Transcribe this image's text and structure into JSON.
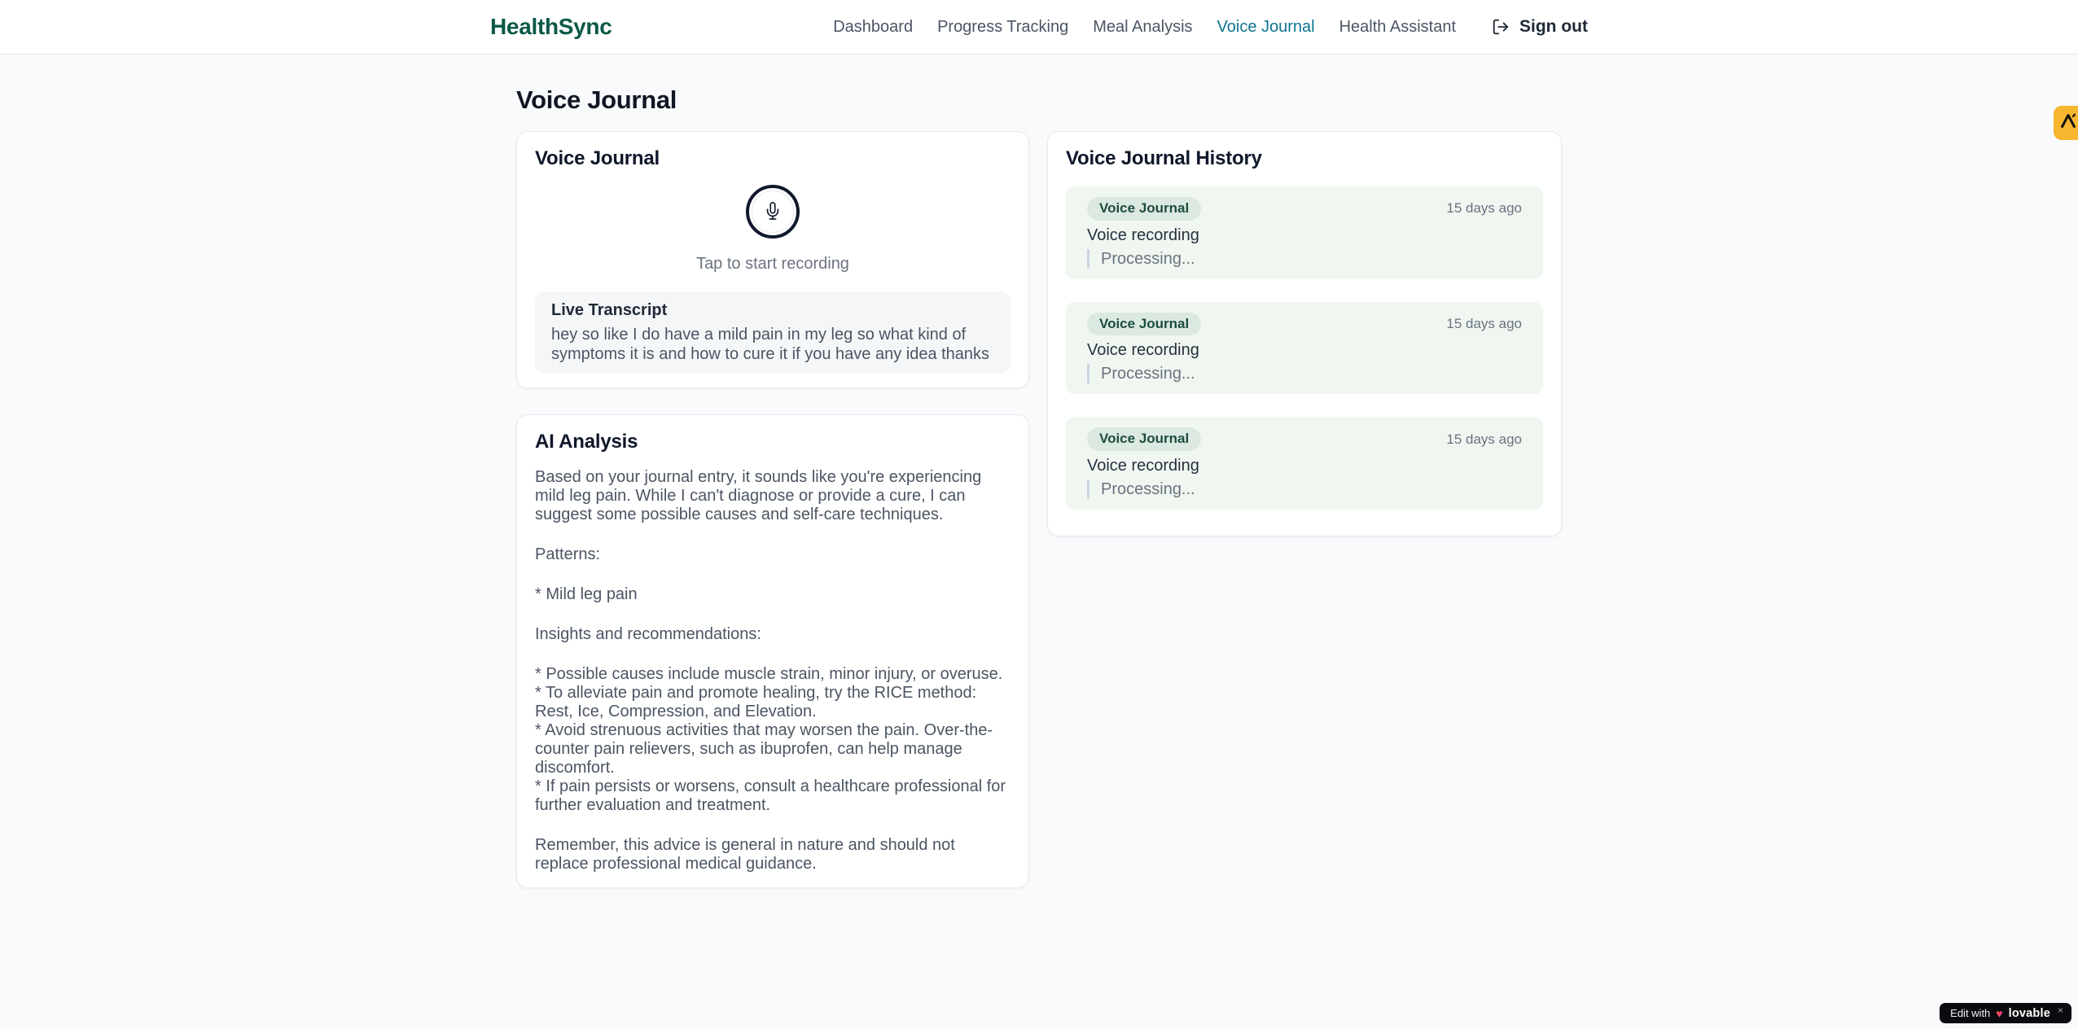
{
  "brand": {
    "name": "HealthSync",
    "color": "#0a5948"
  },
  "nav": {
    "items": [
      {
        "label": "Dashboard",
        "active": false
      },
      {
        "label": "Progress Tracking",
        "active": false
      },
      {
        "label": "Meal Analysis",
        "active": false
      },
      {
        "label": "Voice Journal",
        "active": true
      },
      {
        "label": "Health Assistant",
        "active": false
      }
    ],
    "active_color": "#0e7490",
    "sign_out_label": "Sign out"
  },
  "page": {
    "title": "Voice Journal",
    "background": "#f8fafc"
  },
  "recorder_card": {
    "title": "Voice Journal",
    "tap_hint": "Tap to start recording",
    "transcript": {
      "title": "Live Transcript",
      "text": "hey so like I do have a mild pain in my leg so what kind of symptoms it is and how to cure it if you have any idea thanks"
    }
  },
  "analysis_card": {
    "title": "AI Analysis",
    "paragraphs": [
      "Based on your journal entry, it sounds like you're experiencing mild leg pain. While I can't diagnose or provide a cure, I can suggest some possible causes and self-care techniques.",
      "Patterns:",
      "* Mild leg pain",
      "Insights and recommendations:",
      "* Possible causes include muscle strain, minor injury, or overuse.\n* To alleviate pain and promote healing, try the RICE method: Rest, Ice, Compression, and Elevation.\n* Avoid strenuous activities that may worsen the pain. Over-the-counter pain relievers, such as ibuprofen, can help manage discomfort.\n* If pain persists or worsens, consult a healthcare professional for further evaluation and treatment.",
      "Remember, this advice is general in nature and should not replace professional medical guidance."
    ]
  },
  "history_card": {
    "title": "Voice Journal History",
    "entry_background": "#f0f7f1",
    "badge_background": "#dce9e1",
    "badge_text_color": "#1d4c41",
    "entries": [
      {
        "badge": "Voice Journal",
        "time": "15 days ago",
        "label": "Voice recording",
        "status": "Processing..."
      },
      {
        "badge": "Voice Journal",
        "time": "15 days ago",
        "label": "Voice recording",
        "status": "Processing..."
      },
      {
        "badge": "Voice Journal",
        "time": "15 days ago",
        "label": "Voice recording",
        "status": "Processing..."
      }
    ]
  },
  "floating": {
    "side_tab": {
      "icon": "lambda-logo",
      "background": "#f6b62e"
    },
    "edit_badge": {
      "prefix": "Edit with",
      "heart": "♥",
      "brand_label": "lovable",
      "close": "×"
    }
  }
}
